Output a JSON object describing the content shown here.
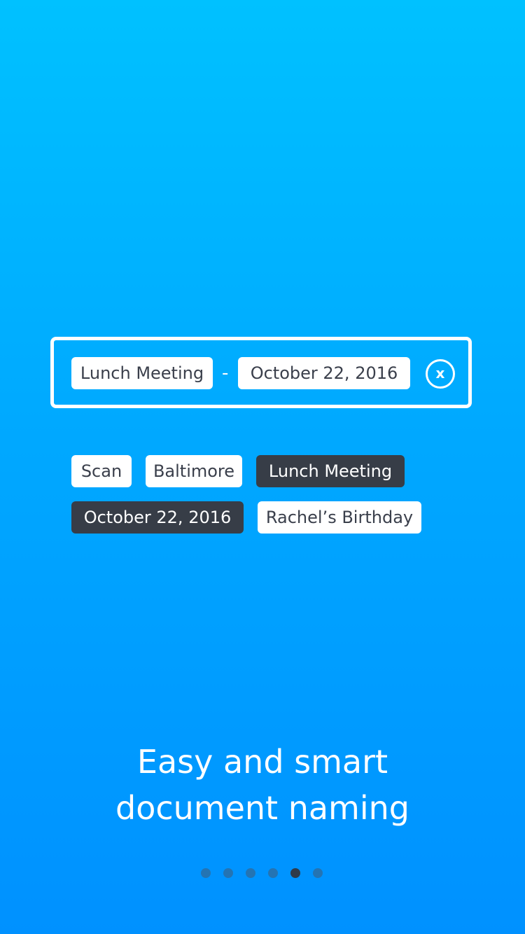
{
  "name_field": {
    "chips": [
      "Lunch Meeting",
      "October 22, 2016"
    ],
    "separator": "-",
    "clear_label": "x"
  },
  "tags": [
    {
      "label": "Scan",
      "selected": false
    },
    {
      "label": "Baltimore",
      "selected": false
    },
    {
      "label": "Lunch Meeting",
      "selected": true
    },
    {
      "label": "October 22, 2016",
      "selected": true
    },
    {
      "label": "Rachel’s Birthday",
      "selected": false
    }
  ],
  "headline": {
    "line1": "Easy and smart",
    "line2": "document naming"
  },
  "pager": {
    "total": 6,
    "active_index": 4
  },
  "colors": {
    "background_top": "#00c1ff",
    "background_bottom": "#0091ff",
    "chip_light": "#ffffff",
    "chip_dark": "#373d47"
  }
}
